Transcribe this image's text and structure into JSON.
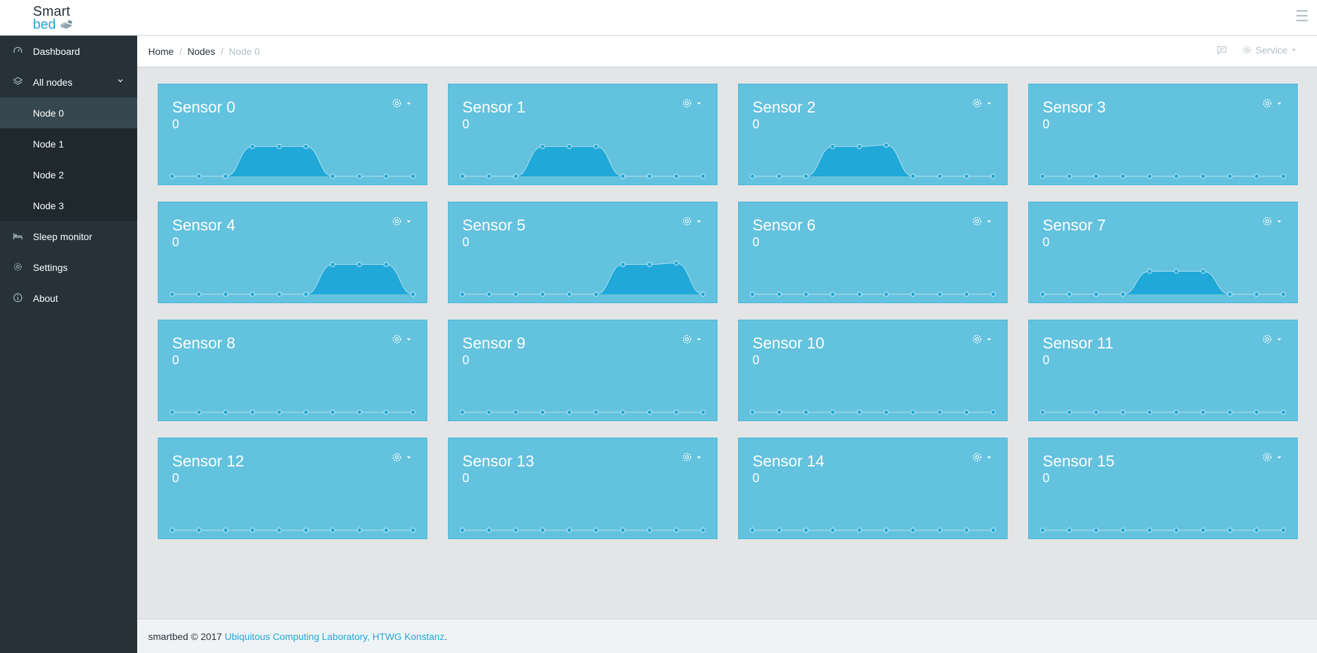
{
  "brand": {
    "line1": "Smart",
    "line2": "bed"
  },
  "colors": {
    "accent": "#20a8d8",
    "sidebar": "#263238",
    "card": "#63c2de",
    "area": "#20a8d8"
  },
  "sidebar": {
    "items": [
      {
        "label": "Dashboard",
        "icon": "speedometer-icon"
      },
      {
        "label": "All nodes",
        "icon": "layers-icon",
        "expanded": true,
        "children": [
          {
            "label": "Node 0",
            "active": true
          },
          {
            "label": "Node 1"
          },
          {
            "label": "Node 2"
          },
          {
            "label": "Node 3"
          }
        ]
      },
      {
        "label": "Sleep monitor",
        "icon": "bed-icon"
      },
      {
        "label": "Settings",
        "icon": "gear-icon"
      },
      {
        "label": "About",
        "icon": "info-icon"
      }
    ]
  },
  "breadcrumb": {
    "home": "Home",
    "nodes": "Nodes",
    "current": "Node 0",
    "sep": "/"
  },
  "header": {
    "service_label": "Service"
  },
  "sensors": [
    {
      "name": "Sensor 0",
      "value": "0",
      "series": [
        0,
        0,
        0,
        1.1,
        1.1,
        1.1,
        0,
        0,
        0,
        0
      ]
    },
    {
      "name": "Sensor 1",
      "value": "0",
      "series": [
        0,
        0,
        0,
        1.1,
        1.1,
        1.1,
        0,
        0,
        0,
        0
      ]
    },
    {
      "name": "Sensor 2",
      "value": "0",
      "series": [
        0,
        0,
        0,
        1.1,
        1.1,
        1.15,
        0,
        0,
        0,
        0
      ]
    },
    {
      "name": "Sensor 3",
      "value": "0",
      "series": [
        0,
        0,
        0,
        0,
        0,
        0,
        0,
        0,
        0,
        0
      ]
    },
    {
      "name": "Sensor 4",
      "value": "0",
      "series": [
        0,
        0,
        0,
        0,
        0,
        0,
        1.1,
        1.1,
        1.1,
        0
      ]
    },
    {
      "name": "Sensor 5",
      "value": "0",
      "series": [
        0,
        0,
        0,
        0,
        0,
        0,
        1.1,
        1.1,
        1.15,
        0
      ]
    },
    {
      "name": "Sensor 6",
      "value": "0",
      "series": [
        0,
        0,
        0,
        0,
        0,
        0,
        0,
        0,
        0,
        0
      ]
    },
    {
      "name": "Sensor 7",
      "value": "0",
      "series": [
        0,
        0,
        0,
        0,
        0.85,
        0.85,
        0.85,
        0,
        0,
        0
      ]
    },
    {
      "name": "Sensor 8",
      "value": "0",
      "series": [
        0,
        0,
        0,
        0,
        0,
        0,
        0,
        0,
        0,
        0
      ]
    },
    {
      "name": "Sensor 9",
      "value": "0",
      "series": [
        0,
        0,
        0,
        0,
        0,
        0,
        0,
        0,
        0,
        0
      ]
    },
    {
      "name": "Sensor 10",
      "value": "0",
      "series": [
        0,
        0,
        0,
        0,
        0,
        0,
        0,
        0,
        0,
        0
      ]
    },
    {
      "name": "Sensor 11",
      "value": "0",
      "series": [
        0,
        0,
        0,
        0,
        0,
        0,
        0,
        0,
        0,
        0
      ]
    },
    {
      "name": "Sensor 12",
      "value": "0",
      "series": [
        0,
        0,
        0,
        0,
        0,
        0,
        0,
        0,
        0,
        0
      ]
    },
    {
      "name": "Sensor 13",
      "value": "0",
      "series": [
        0,
        0,
        0,
        0,
        0,
        0,
        0,
        0,
        0,
        0
      ]
    },
    {
      "name": "Sensor 14",
      "value": "0",
      "series": [
        0,
        0,
        0,
        0,
        0,
        0,
        0,
        0,
        0,
        0
      ]
    },
    {
      "name": "Sensor 15",
      "value": "0",
      "series": [
        0,
        0,
        0,
        0,
        0,
        0,
        0,
        0,
        0,
        0
      ]
    }
  ],
  "footer": {
    "text": "smartbed © 2017",
    "link": "Ubiquitous Computing Laboratory, HTWG Konstanz",
    "end": "."
  }
}
